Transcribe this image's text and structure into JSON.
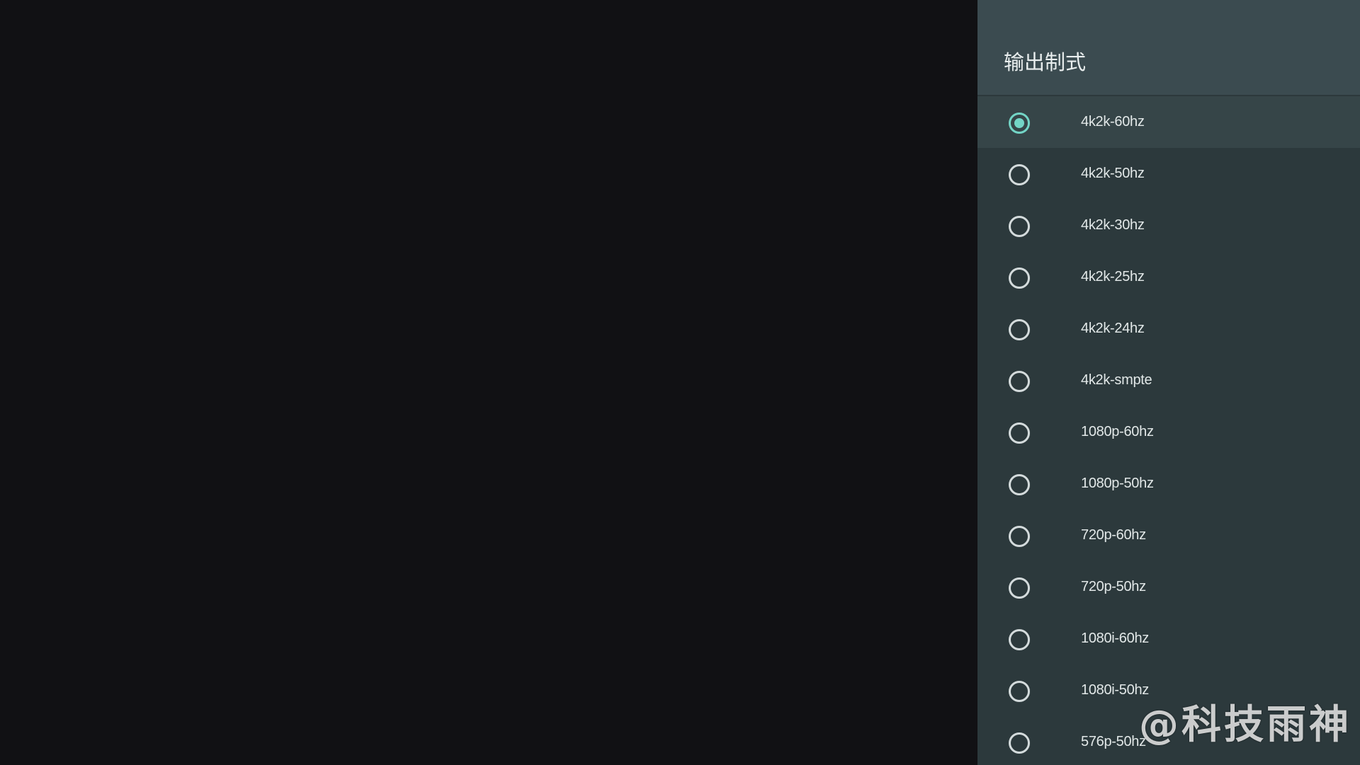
{
  "colors": {
    "background": "#111114",
    "panel": "#2c393c",
    "panel_header": "#3b4b50",
    "accent": "#73d5c6"
  },
  "panel": {
    "title": "输出制式",
    "selected_index": 0,
    "options": [
      {
        "label": "4k2k-60hz",
        "checked": true
      },
      {
        "label": "4k2k-50hz",
        "checked": false
      },
      {
        "label": "4k2k-30hz",
        "checked": false
      },
      {
        "label": "4k2k-25hz",
        "checked": false
      },
      {
        "label": "4k2k-24hz",
        "checked": false
      },
      {
        "label": "4k2k-smpte",
        "checked": false
      },
      {
        "label": "1080p-60hz",
        "checked": false
      },
      {
        "label": "1080p-50hz",
        "checked": false
      },
      {
        "label": "720p-60hz",
        "checked": false
      },
      {
        "label": "720p-50hz",
        "checked": false
      },
      {
        "label": "1080i-60hz",
        "checked": false
      },
      {
        "label": "1080i-50hz",
        "checked": false
      },
      {
        "label": "576p-50hz",
        "checked": false
      }
    ]
  },
  "watermark": "@科技雨神"
}
